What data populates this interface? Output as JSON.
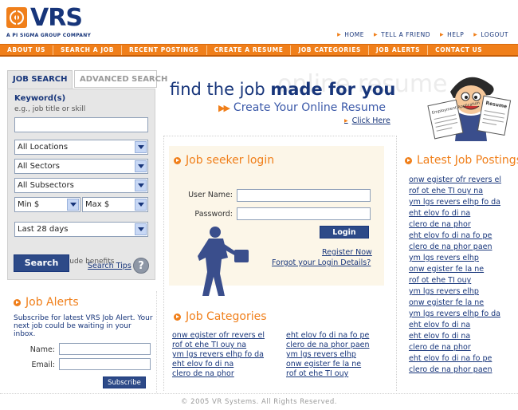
{
  "brand": {
    "logo_text": "VRS",
    "tagline": "A PI SIGMA GROUP COMPANY",
    "accent_color": "#f07f1a",
    "primary_color": "#17357a"
  },
  "top_links": [
    "HOME",
    "TELL A FRIEND",
    "HELP",
    "LOGOUT"
  ],
  "nav": [
    "ABOUT US",
    "SEARCH A JOB",
    "RECENT POSTINGS",
    "CREATE A RESUME",
    "JOB CATEGORIES",
    "JOB ALERTS",
    "CONTACT US"
  ],
  "search": {
    "tab_active": "JOB SEARCH",
    "tab_inactive": "ADVANCED SEARCH",
    "keyword_label": "Keyword(s)",
    "keyword_hint": "e.g., job title or skill",
    "keyword_value": "",
    "location": "All Locations",
    "sector": "All Sectors",
    "subsector": "All Subsectors",
    "min_salary": "Min $",
    "max_salary": "Max $",
    "date_range": "Last 28 days",
    "salary_note": "Salary may include benefits",
    "search_button": "Search",
    "tips_link": "Search Tips",
    "help_glyph": "?"
  },
  "job_alerts": {
    "title": "Job Alerts",
    "description": "Subscribe for latest VRS Job Alert. Your next job could be waiting in your inbox.",
    "name_label": "Name:",
    "email_label": "Email:",
    "subscribe_button": "Subscribe"
  },
  "hero": {
    "title_prefix": "find the job ",
    "title_bold": "made for you",
    "watermark": "online resume",
    "subtitle": "Create Your Online Resume",
    "arrows": "▶▶",
    "link": "Click Here",
    "mascot_papers": [
      "Employment Application",
      "Resume"
    ]
  },
  "login": {
    "title": "Job seeker login",
    "username_label": "User Name:",
    "password_label": "Password:",
    "login_button": "Login",
    "register_link": "Register Now",
    "forgot_link": "Forgot your Login Details?"
  },
  "categories": {
    "title": "Job Categories",
    "col1": [
      "onw egister ofr revers el",
      "rof ot ehe TI ouy na",
      "ym lgs revers elhp fo da",
      "eht elov fo di na",
      "clero de na phor"
    ],
    "col2": [
      "eht elov fo di na fo pe",
      "clero de na phor paen",
      "ym lgs revers elhp",
      "onw egister fe la ne",
      "rof ot ehe TI ouy"
    ]
  },
  "latest": {
    "title": "Latest Job Postings",
    "items": [
      "onw egister ofr revers el",
      "rof ot ehe TI ouy na",
      "ym lgs revers elhp fo da",
      "eht elov fo di na",
      "clero de na phor",
      "eht elov fo di na fo pe",
      "clero de na phor paen",
      "ym lgs revers elhp",
      "onw egister fe la ne",
      "rof ot ehe TI ouy",
      "ym lgs revers elhp",
      "onw egister fe la ne",
      "ym lgs revers elhp fo da",
      "eht elov fo di na",
      "eht elov fo di na",
      "clero de na phor",
      "eht elov fo di na fo pe",
      "clero de na phor paen"
    ]
  },
  "footer": "© 2005 VR Systems. All Rights Reserved."
}
